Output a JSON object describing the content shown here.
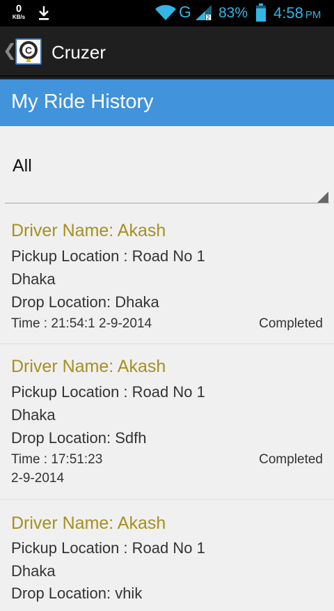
{
  "status_bar": {
    "net_speed": "0",
    "net_speed_unit": "KB/s",
    "network_type": "G",
    "battery_percent": "83%",
    "time": "4:58",
    "ampm": "PM",
    "icons": [
      "download-icon",
      "wifi-icon",
      "signal-icon",
      "battery-icon"
    ]
  },
  "action_bar": {
    "app_name": "Cruzer",
    "back_glyph": "❮",
    "logo_letter": "C",
    "brand_colors": {
      "logo_ring": "#2b2b2b",
      "logo_pin": "#f0a800"
    }
  },
  "header": {
    "title": "My Ride History",
    "color": "#4193db"
  },
  "filter": {
    "selected": "All"
  },
  "rides": [
    {
      "driver": "Driver Name: Akash",
      "pickup_line1": "Pickup Location : Road No 1",
      "pickup_line2": "Dhaka",
      "drop": "Drop Location: Dhaka",
      "time_line1": "Time : 21:54:1 2-9-2014",
      "time_line2": "",
      "status": "Completed"
    },
    {
      "driver": "Driver Name: Akash",
      "pickup_line1": "Pickup Location : Road No 1",
      "pickup_line2": "Dhaka",
      "drop": "Drop Location: Sdfh",
      "time_line1": "Time : 17:51:23",
      "time_line2": "2-9-2014",
      "status": "Completed"
    },
    {
      "driver": "Driver Name: Akash",
      "pickup_line1": "Pickup Location : Road No 1",
      "pickup_line2": "Dhaka",
      "drop": "Drop Location: vhik",
      "time_line1": "",
      "time_line2": "",
      "status": ""
    }
  ]
}
